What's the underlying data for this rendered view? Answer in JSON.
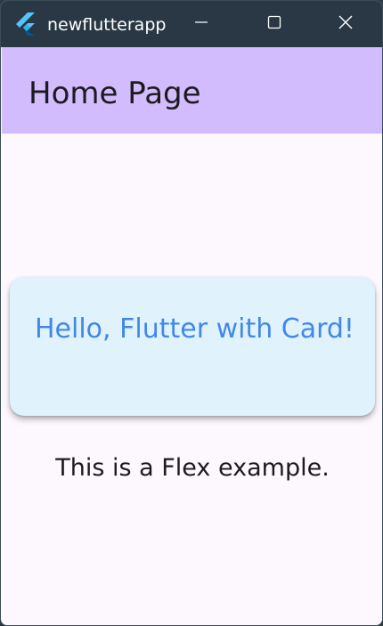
{
  "window": {
    "title": "newflutterapp",
    "app_icon": "flutter-logo-icon",
    "controls": {
      "minimize_icon": "minimize-icon",
      "maximize_icon": "maximize-icon",
      "close_icon": "close-icon"
    }
  },
  "appbar": {
    "title": "Home Page",
    "background": "#d3bcfd"
  },
  "main": {
    "card": {
      "text": "Hello, Flutter with Card!",
      "background": "#e0f3fc",
      "text_color": "#4287ea"
    },
    "flex_text": "This is a Flex example."
  },
  "colors": {
    "titlebar": "#293844",
    "page_background": "#fdf7fe"
  }
}
